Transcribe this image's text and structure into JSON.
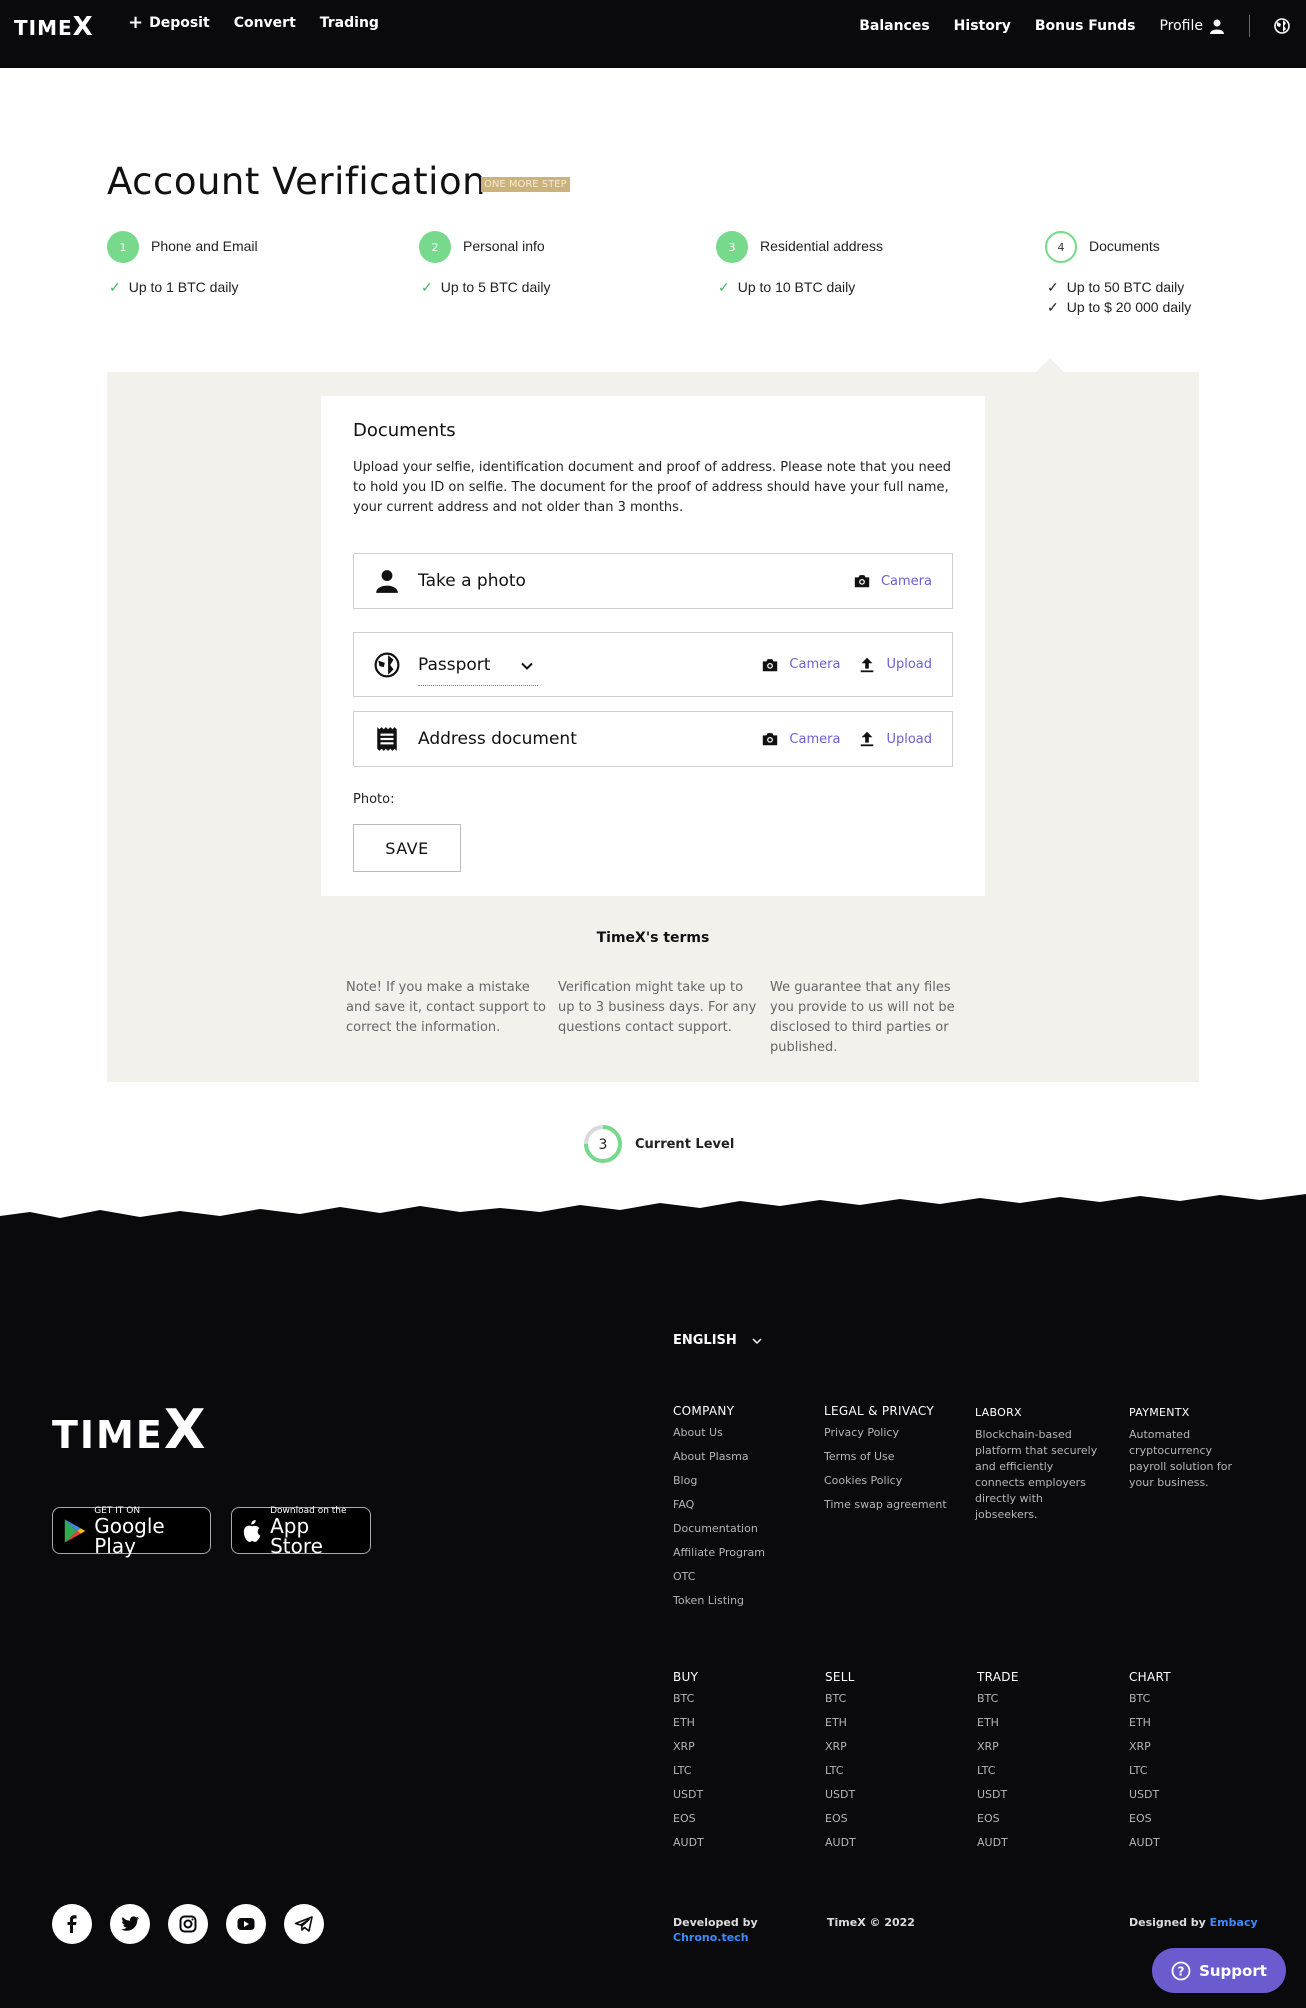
{
  "header": {
    "logo": "TIMEX",
    "nav_left": [
      {
        "label": "Deposit"
      },
      {
        "label": "Convert"
      },
      {
        "label": "Trading"
      }
    ],
    "nav_right": [
      {
        "label": "Balances"
      },
      {
        "label": "History"
      },
      {
        "label": "Bonus Funds"
      },
      {
        "label": "Profile"
      }
    ]
  },
  "page": {
    "title": "Account Verification",
    "badge": "ONE MORE STEP"
  },
  "steps": [
    {
      "number": "1",
      "title": "Phone and Email",
      "limits": [
        "Up to 1 BTC daily"
      ],
      "state": "done"
    },
    {
      "number": "2",
      "title": "Personal info",
      "limits": [
        "Up to 5 BTC daily"
      ],
      "state": "done"
    },
    {
      "number": "3",
      "title": "Residential address",
      "limits": [
        "Up to 10 BTC daily"
      ],
      "state": "done"
    },
    {
      "number": "4",
      "title": "Documents",
      "limits": [
        "Up to 50 BTC daily",
        "Up to $ 20 000 daily"
      ],
      "state": "current"
    }
  ],
  "documents": {
    "title": "Documents",
    "description": "Upload your selfie, identification document and proof of address. Please note that you need to hold you ID on selfie. The document for the proof of address should have your full name, your current address and not older than 3 months.",
    "rows": {
      "selfie": {
        "label": "Take a photo",
        "camera": "Camera"
      },
      "id": {
        "label": "Passport",
        "camera": "Camera",
        "upload": "Upload"
      },
      "address": {
        "label": "Address document",
        "camera": "Camera",
        "upload": "Upload"
      }
    },
    "photo_label": "Photo:",
    "save_label": "SAVE"
  },
  "terms": {
    "title": "TimeX's terms",
    "items": [
      "Note! If you make a mistake and save it, contact support to correct the information.",
      "Verification might take up to up to 3 business days. For any questions contact support.",
      "We guarantee that any files you provide to us will not be disclosed to third parties or published."
    ]
  },
  "current_level": {
    "value": "3",
    "label": "Current Level",
    "progress": 0.75
  },
  "footer": {
    "language": "ENGLISH",
    "logo": "TIMEX",
    "stores": {
      "google_small": "GET IT ON",
      "google_big": "Google Play",
      "apple_small": "Download on the",
      "apple_big": "App Store"
    },
    "company": {
      "head": "COMPANY",
      "links": [
        "About Us",
        "About Plasma",
        "Blog",
        "FAQ",
        "Documentation",
        "Affiliate Program",
        "OTC",
        "Token Listing"
      ]
    },
    "legal": {
      "head": "LEGAL & PRIVACY",
      "links": [
        "Privacy Policy",
        "Terms of Use",
        "Cookies Policy",
        "Time swap agreement"
      ]
    },
    "laborx": {
      "head": "LABORX",
      "desc": "Blockchain-based platform that securely and efficiently connects employers directly with jobseekers."
    },
    "paymentx": {
      "head": "PAYMENTX",
      "desc": "Automated cryptocurrency payroll solution for your business."
    },
    "buy": {
      "head": "BUY",
      "links": [
        "BTC",
        "ETH",
        "XRP",
        "LTC",
        "USDT",
        "EOS",
        "AUDT"
      ]
    },
    "sell": {
      "head": "SELL",
      "links": [
        "BTC",
        "ETH",
        "XRP",
        "LTC",
        "USDT",
        "EOS",
        "AUDT"
      ]
    },
    "trade": {
      "head": "TRADE",
      "links": [
        "BTC",
        "ETH",
        "XRP",
        "LTC",
        "USDT",
        "EOS",
        "AUDT"
      ]
    },
    "chart": {
      "head": "CHART",
      "links": [
        "BTC",
        "ETH",
        "XRP",
        "LTC",
        "USDT",
        "EOS",
        "AUDT"
      ]
    },
    "developed_by": "Developed by",
    "developer": "Chrono.tech",
    "copyright": "TimeX © 2022",
    "designed_by": "Designed by",
    "designer": "Embacy",
    "support": "Support"
  },
  "colors": {
    "accent": "#6c5fd3",
    "step_green": "#77d98c",
    "badge": "#c9b27c",
    "footer_bg": "#0a0a0c",
    "panel_bg": "#f3f1ec"
  }
}
